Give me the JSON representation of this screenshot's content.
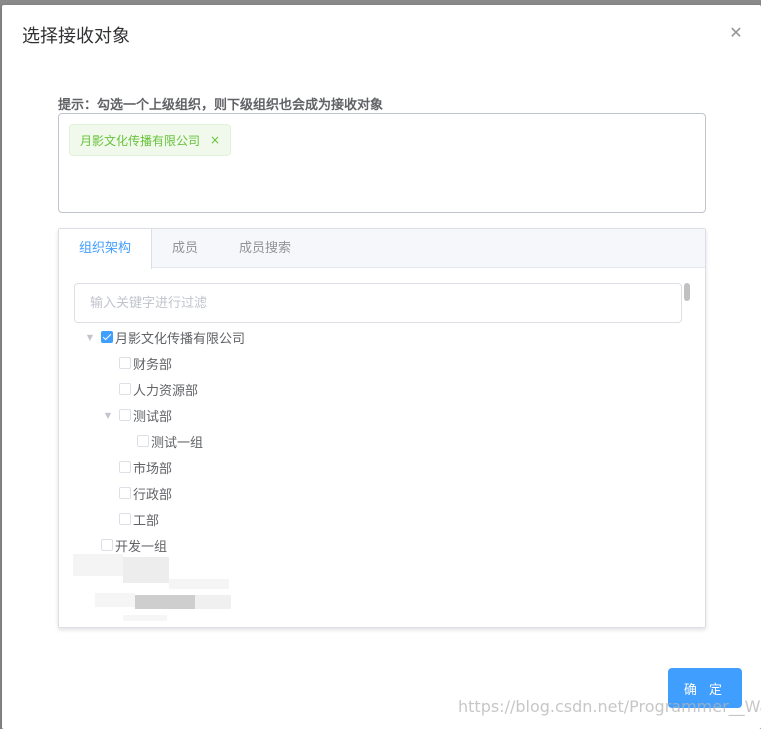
{
  "dialog": {
    "title": "选择接收对象",
    "close_icon": "close-icon",
    "hint": "提示：勾选一个上级组织，则下级组织也会成为接收对象",
    "selected_tags": [
      {
        "label": "月影文化传播有限公司",
        "close_icon": "×"
      }
    ],
    "tabs": [
      {
        "label": "组织架构",
        "active": true
      },
      {
        "label": "成员",
        "active": false
      },
      {
        "label": "成员搜索",
        "active": false
      }
    ],
    "filter": {
      "placeholder": "输入关键字进行过滤",
      "value": ""
    },
    "tree": [
      {
        "label": "月影文化传播有限公司",
        "level": 0,
        "expanded": true,
        "checked": true,
        "has_children": true
      },
      {
        "label": "财务部",
        "level": 1,
        "checked": false,
        "has_children": false
      },
      {
        "label": "人力资源部",
        "level": 1,
        "checked": false,
        "has_children": false
      },
      {
        "label": "测试部",
        "level": 1,
        "expanded": true,
        "checked": false,
        "has_children": true
      },
      {
        "label": "测试一组",
        "level": 2,
        "checked": false,
        "has_children": false
      },
      {
        "label": "市场部",
        "level": 1,
        "checked": false,
        "has_children": false
      },
      {
        "label": "行政部",
        "level": 1,
        "checked": false,
        "has_children": false
      },
      {
        "label": "工部",
        "level": 1,
        "checked": false,
        "has_children": false
      },
      {
        "label": "开发一组",
        "level": 0,
        "checked": false,
        "has_children": false
      }
    ],
    "confirm_label": "确 定"
  },
  "watermark": "https://blog.csdn.net/Programmer__Wang",
  "colors": {
    "accent": "#409eff",
    "tag_green": "#67c23a",
    "tag_bg": "#f0f9eb"
  }
}
